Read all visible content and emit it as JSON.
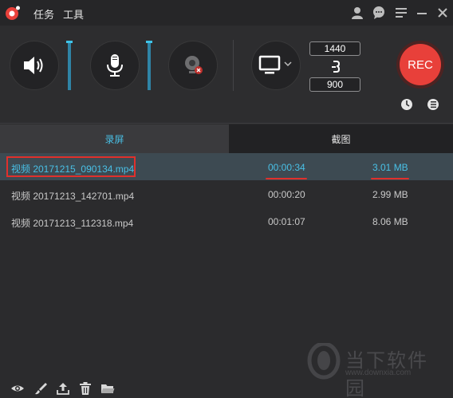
{
  "titlebar": {
    "menu_task": "任务",
    "menu_tools": "工具"
  },
  "panel": {
    "speaker_volume": 1.0,
    "mic_volume": 1.0,
    "resolution_width": "1440",
    "resolution_height": "900",
    "rec_label": "REC"
  },
  "tabs": {
    "screen_recording": "录屏",
    "screenshot": "截图"
  },
  "files": [
    {
      "name": "视频 20171215_090134.mp4",
      "duration": "00:00:34",
      "size": "3.01 MB"
    },
    {
      "name": "视频 20171213_142701.mp4",
      "duration": "00:00:20",
      "size": "2.99 MB"
    },
    {
      "name": "视频 20171213_112318.mp4",
      "duration": "00:01:07",
      "size": "8.06 MB"
    }
  ],
  "watermark": {
    "brand": "当下软件园",
    "url": "www.downxia.com"
  },
  "colors": {
    "accent": "#49c0e6",
    "record": "#e8403a",
    "annotation": "#e0302c"
  }
}
